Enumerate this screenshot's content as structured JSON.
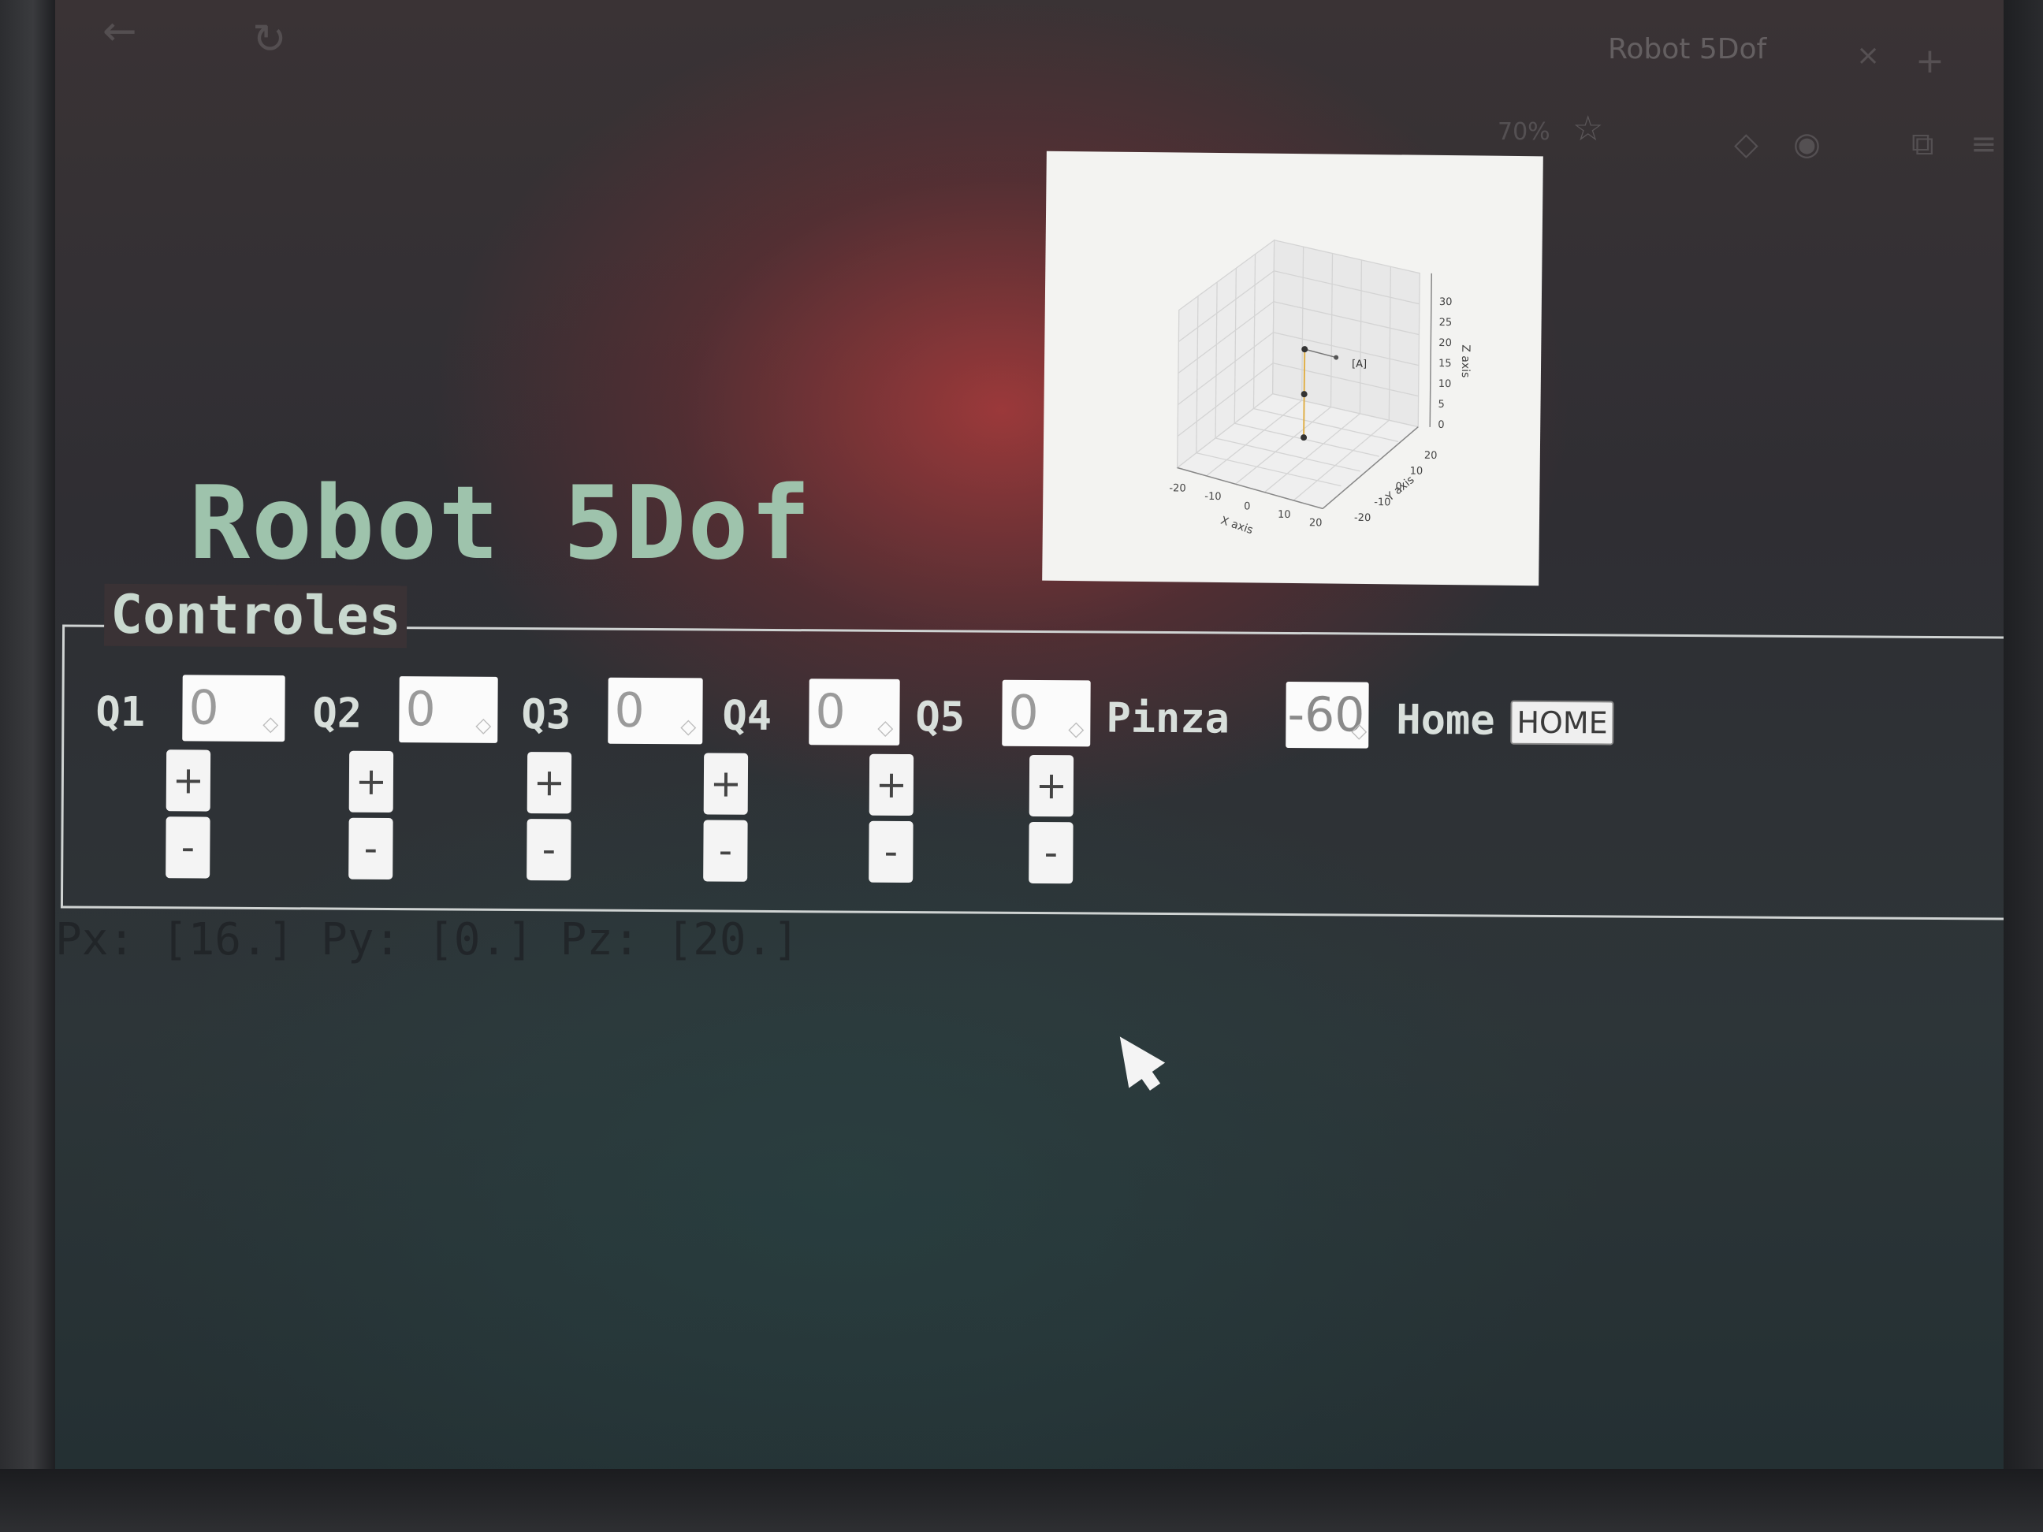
{
  "browser": {
    "tab_title": "Robot 5Dof",
    "zoom": "70%",
    "new_tab": "+",
    "tab_close": "×"
  },
  "page": {
    "title": "Robot 5Dof"
  },
  "plot": {
    "x_label": "X axis",
    "y_label": "Y axis",
    "z_label": "Z axis",
    "x_ticks": [
      "-20",
      "-10",
      "0",
      "10",
      "20"
    ],
    "y_ticks": [
      "20",
      "10",
      "0",
      "-10",
      "-20"
    ],
    "z_ticks": [
      "30",
      "25",
      "20",
      "15",
      "10",
      "5",
      "0"
    ],
    "gripper_label": "[A]"
  },
  "controls": {
    "legend": "Controles",
    "joints": [
      {
        "label": "Q1",
        "value": "0"
      },
      {
        "label": "Q2",
        "value": "0"
      },
      {
        "label": "Q3",
        "value": "0"
      },
      {
        "label": "Q4",
        "value": "0"
      },
      {
        "label": "Q5",
        "value": "0"
      }
    ],
    "gripper": {
      "label": "Pinza",
      "value": "-60"
    },
    "home": {
      "label": "Home",
      "button": "HOME"
    },
    "plus": "+",
    "minus": "-",
    "spinner": "◇"
  },
  "readout": {
    "text": "Px: [16.] Py: [0.] Pz: [20.]"
  },
  "colors": {
    "title": "#9ec3ac",
    "legend": "#c9d9cf",
    "fieldset_border": "#cfd3d2"
  }
}
